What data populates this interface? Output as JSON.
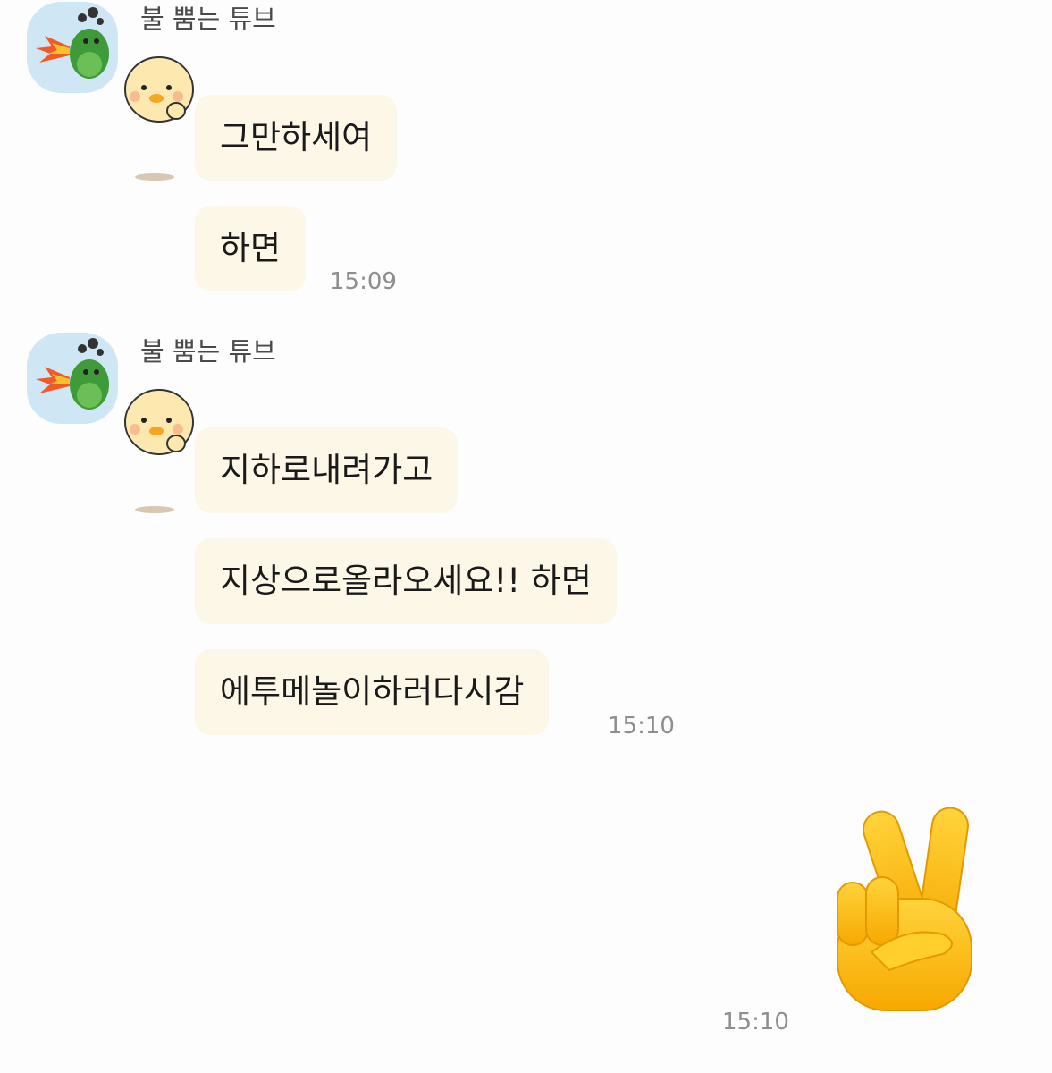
{
  "chat": {
    "groups": [
      {
        "sender": "불 뿜는 튜브",
        "messages": [
          "그만하세여",
          "하면"
        ],
        "time": "15:09"
      },
      {
        "sender": "불 뿜는 튜브",
        "messages": [
          "지하로내려가고",
          "지상으로올라오세요!! 하면",
          "에투메놀이하러다시감"
        ],
        "time": "15:10"
      }
    ],
    "outgoing": {
      "emoji": "victory-hand",
      "time": "15:10"
    }
  },
  "colors": {
    "background": "#fdfdfd",
    "bubble": "#fdf7e8",
    "avatar_bg": "#cfe6f5",
    "time_text": "#8e8e8e"
  }
}
